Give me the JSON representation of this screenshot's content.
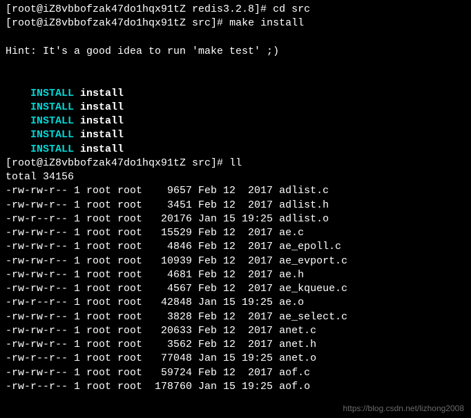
{
  "prompt_user": "root",
  "prompt_host": "iZ8vbbofzak47do1hqx91tZ",
  "lines": [
    {
      "prompt_dir": "redis3.2.8",
      "cmd": "cd src"
    },
    {
      "prompt_dir": "src",
      "cmd": "make install"
    }
  ],
  "hint": "Hint: It's a good idea to run 'make test' ;)",
  "install_label": "INSTALL",
  "install_target": "install",
  "install_count": 5,
  "ll_prompt_dir": "src",
  "ll_cmd": "ll",
  "total_line": "total 34156",
  "columns": [
    "perms",
    "links",
    "owner",
    "group",
    "size",
    "month",
    "day",
    "time_or_year",
    "name"
  ],
  "files": [
    {
      "perms": "-rw-rw-r--",
      "links": "1",
      "owner": "root",
      "group": "root",
      "size": "9657",
      "month": "Feb",
      "day": "12",
      "time_or_year": "2017",
      "name": "adlist.c"
    },
    {
      "perms": "-rw-rw-r--",
      "links": "1",
      "owner": "root",
      "group": "root",
      "size": "3451",
      "month": "Feb",
      "day": "12",
      "time_or_year": "2017",
      "name": "adlist.h"
    },
    {
      "perms": "-rw-r--r--",
      "links": "1",
      "owner": "root",
      "group": "root",
      "size": "20176",
      "month": "Jan",
      "day": "15",
      "time_or_year": "19:25",
      "name": "adlist.o"
    },
    {
      "perms": "-rw-rw-r--",
      "links": "1",
      "owner": "root",
      "group": "root",
      "size": "15529",
      "month": "Feb",
      "day": "12",
      "time_or_year": "2017",
      "name": "ae.c"
    },
    {
      "perms": "-rw-rw-r--",
      "links": "1",
      "owner": "root",
      "group": "root",
      "size": "4846",
      "month": "Feb",
      "day": "12",
      "time_or_year": "2017",
      "name": "ae_epoll.c"
    },
    {
      "perms": "-rw-rw-r--",
      "links": "1",
      "owner": "root",
      "group": "root",
      "size": "10939",
      "month": "Feb",
      "day": "12",
      "time_or_year": "2017",
      "name": "ae_evport.c"
    },
    {
      "perms": "-rw-rw-r--",
      "links": "1",
      "owner": "root",
      "group": "root",
      "size": "4681",
      "month": "Feb",
      "day": "12",
      "time_or_year": "2017",
      "name": "ae.h"
    },
    {
      "perms": "-rw-rw-r--",
      "links": "1",
      "owner": "root",
      "group": "root",
      "size": "4567",
      "month": "Feb",
      "day": "12",
      "time_or_year": "2017",
      "name": "ae_kqueue.c"
    },
    {
      "perms": "-rw-r--r--",
      "links": "1",
      "owner": "root",
      "group": "root",
      "size": "42848",
      "month": "Jan",
      "day": "15",
      "time_or_year": "19:25",
      "name": "ae.o"
    },
    {
      "perms": "-rw-rw-r--",
      "links": "1",
      "owner": "root",
      "group": "root",
      "size": "3828",
      "month": "Feb",
      "day": "12",
      "time_or_year": "2017",
      "name": "ae_select.c"
    },
    {
      "perms": "-rw-rw-r--",
      "links": "1",
      "owner": "root",
      "group": "root",
      "size": "20633",
      "month": "Feb",
      "day": "12",
      "time_or_year": "2017",
      "name": "anet.c"
    },
    {
      "perms": "-rw-rw-r--",
      "links": "1",
      "owner": "root",
      "group": "root",
      "size": "3562",
      "month": "Feb",
      "day": "12",
      "time_or_year": "2017",
      "name": "anet.h"
    },
    {
      "perms": "-rw-r--r--",
      "links": "1",
      "owner": "root",
      "group": "root",
      "size": "77048",
      "month": "Jan",
      "day": "15",
      "time_or_year": "19:25",
      "name": "anet.o"
    },
    {
      "perms": "-rw-rw-r--",
      "links": "1",
      "owner": "root",
      "group": "root",
      "size": "59724",
      "month": "Feb",
      "day": "12",
      "time_or_year": "2017",
      "name": "aof.c"
    },
    {
      "perms": "-rw-r--r--",
      "links": "1",
      "owner": "root",
      "group": "root",
      "size": "178760",
      "month": "Jan",
      "day": "15",
      "time_or_year": "19:25",
      "name": "aof.o"
    }
  ],
  "watermark": "https://blog.csdn.net/lizhong2008"
}
